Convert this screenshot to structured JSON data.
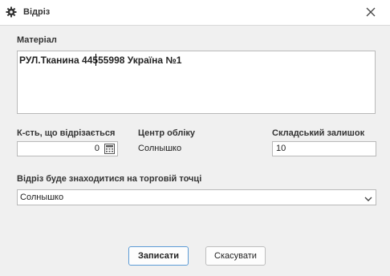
{
  "window": {
    "title": "Відріз",
    "icon": "gear-icon",
    "close_icon": "close-icon"
  },
  "material": {
    "label": "Матеріал",
    "value": "РУЛ.Тканина 44555998 Україна №1"
  },
  "quantity": {
    "label": "К-сть, що відрізається",
    "value": "0",
    "icon": "calculator-icon"
  },
  "accounting_center": {
    "label": "Центр обліку",
    "value": "Солнышко"
  },
  "stock": {
    "label": "Складський залишок",
    "value": "10"
  },
  "location": {
    "label": "Відріз буде знаходитися на торговій точці",
    "selected": "Солнышко",
    "icon": "chevron-down-icon"
  },
  "buttons": {
    "save": "Записати",
    "cancel": "Скасувати"
  },
  "colors": {
    "background": "#f0f0f0",
    "primary_border": "#5c9bd6"
  }
}
